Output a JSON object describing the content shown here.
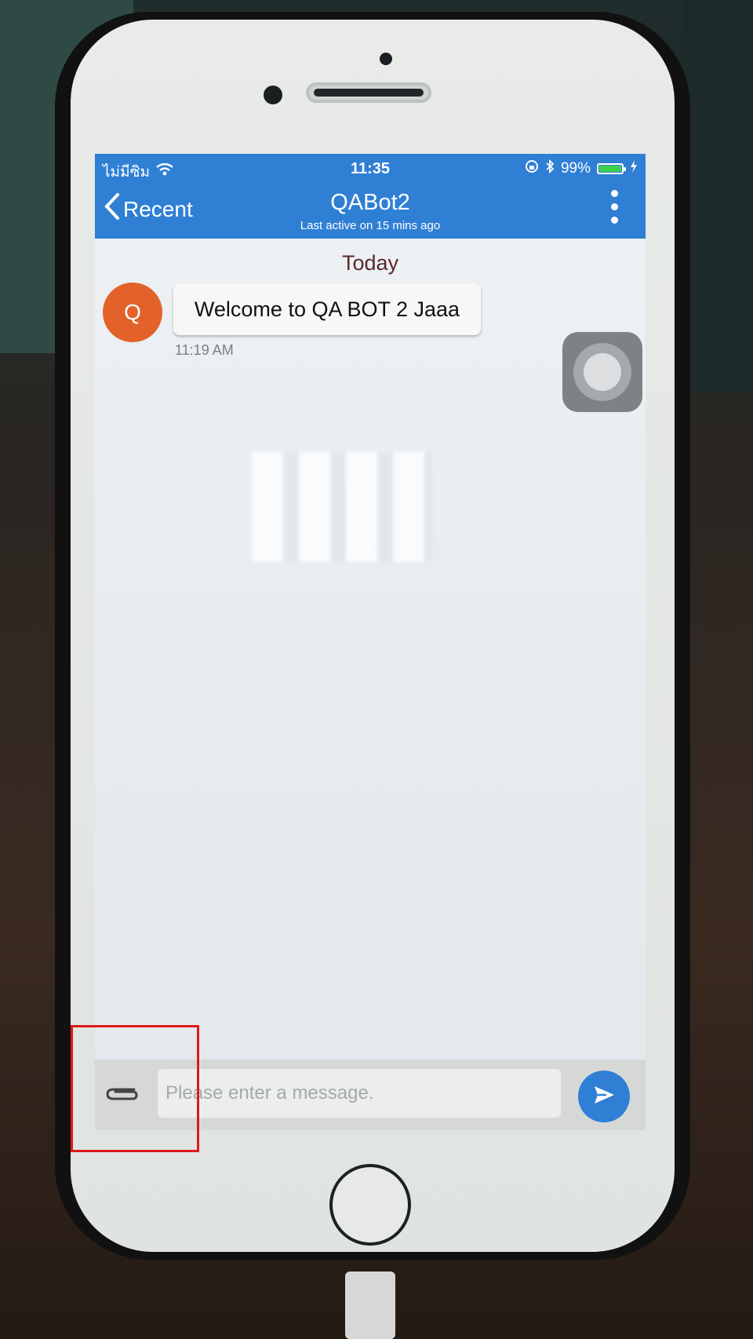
{
  "status_bar": {
    "carrier": "ไม่มีซิม",
    "time": "11:35",
    "battery_percent": "99%",
    "battery_level": 0.99
  },
  "nav": {
    "back_label": "Recent",
    "title": "QABot2",
    "subtitle": "Last active on 15 mins ago"
  },
  "chat": {
    "day_label": "Today",
    "messages": [
      {
        "avatar_initial": "Q",
        "text": "Welcome to QA BOT 2 Jaaa",
        "time": "11:19 AM"
      }
    ]
  },
  "composer": {
    "placeholder": "Please enter a message."
  },
  "colors": {
    "accent": "#2f7fd4",
    "avatar": "#e2622a",
    "highlight": "#e01818"
  }
}
